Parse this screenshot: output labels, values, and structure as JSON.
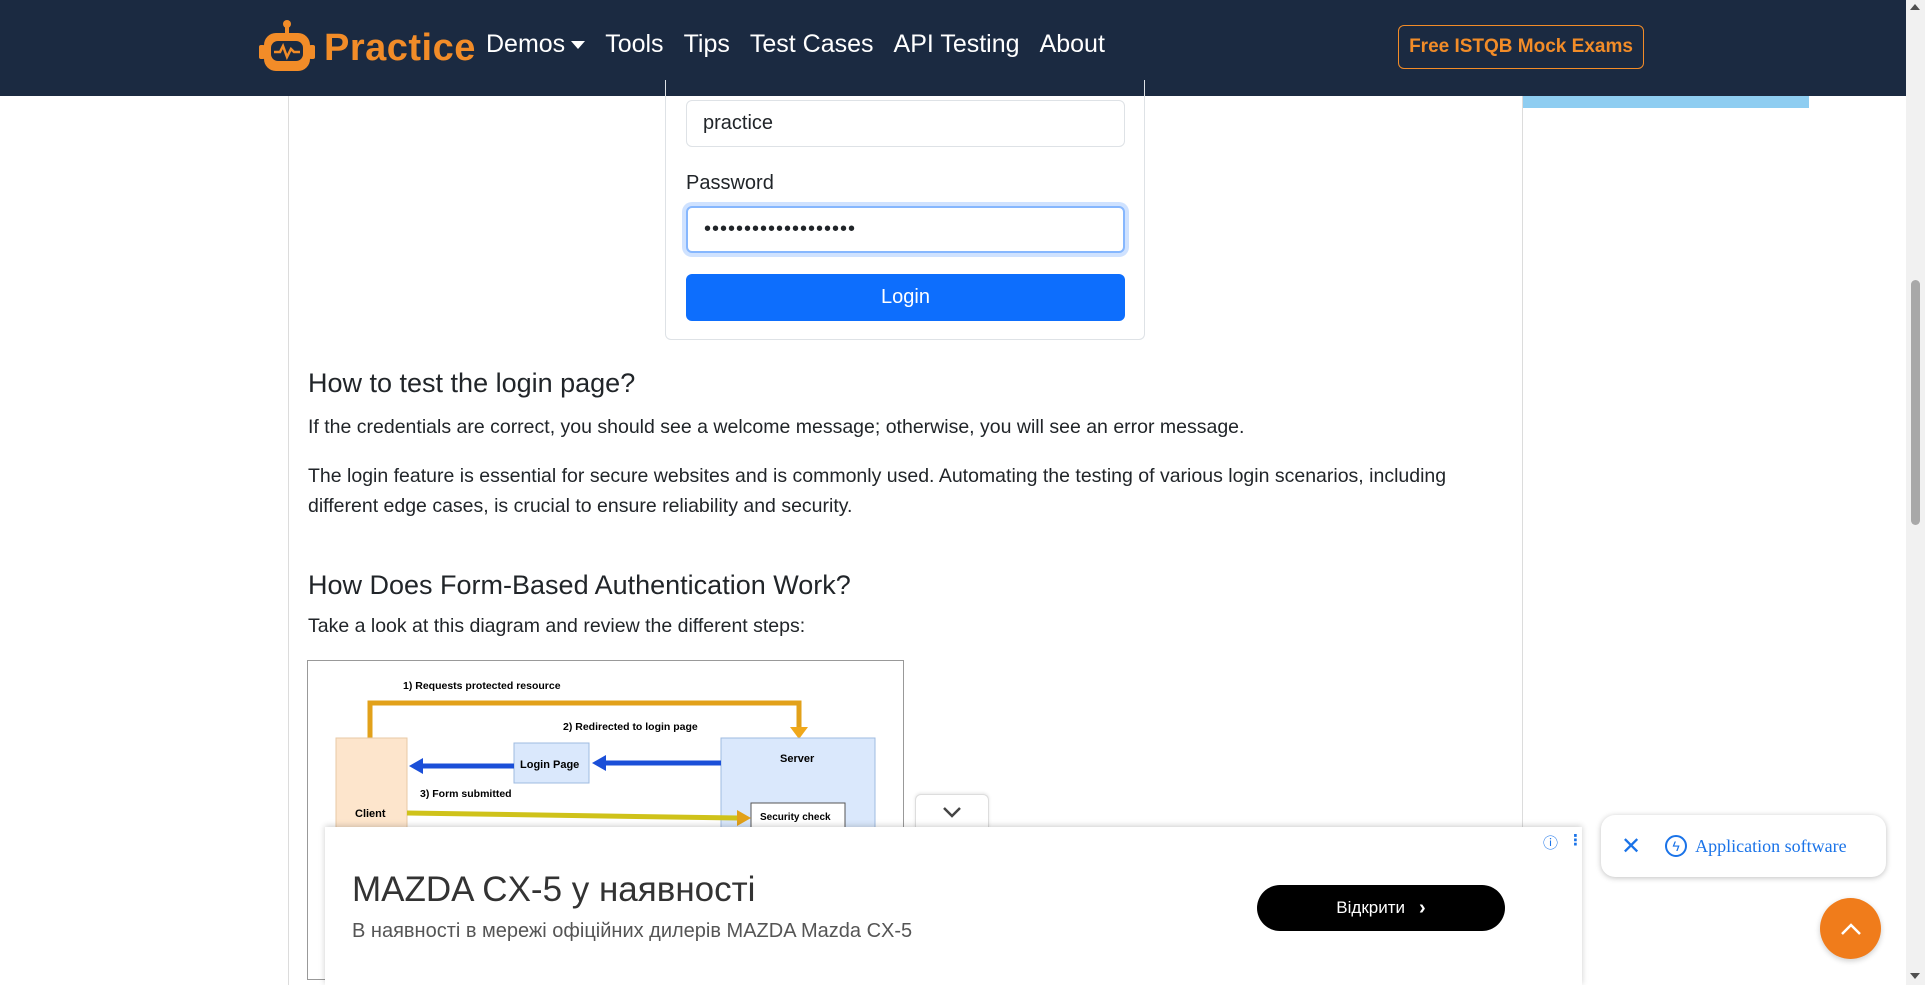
{
  "navbar": {
    "brand": "Practice",
    "items": [
      {
        "label": "Demos",
        "dropdown": true
      },
      {
        "label": "Tools"
      },
      {
        "label": "Tips"
      },
      {
        "label": "Test Cases"
      },
      {
        "label": "API Testing"
      },
      {
        "label": "About"
      }
    ],
    "cta_label": "Free ISTQB Mock Exams"
  },
  "login_form": {
    "username_value": "practice",
    "password_label": "Password",
    "password_value": "•••••••••••••••••••",
    "login_label": "Login"
  },
  "article": {
    "heading_test": "How to test the login page?",
    "para_test": "If the credentials are correct, you should see a welcome message; otherwise, you will see an error message.",
    "para_feature": "The login feature is essential for secure websites and is commonly used. Automating the testing of various login scenarios, including different edge cases, is crucial to ensure reliability and security.",
    "heading_form": "How Does Form-Based Authentication Work?",
    "para_diagram": "Take a look at this diagram and review the different steps:"
  },
  "diagram": {
    "step1": "1) Requests protected resource",
    "step2": "2) Redirected to login page",
    "step3": "3) Form submitted",
    "client": "Client",
    "login_page": "Login Page",
    "server": "Server",
    "security_check": "Security check"
  },
  "ad": {
    "title": "MAZDA CX-5 у наявності",
    "subtitle": "В наявності в мережі офіційних дилерів MAZDA Mazda CX-5",
    "button": "Відкрити"
  },
  "chip": {
    "label": "Application software"
  },
  "colors": {
    "navbar_bg": "#1b2a41",
    "brand_orange": "#f28c28",
    "primary_blue": "#0d6efd"
  }
}
